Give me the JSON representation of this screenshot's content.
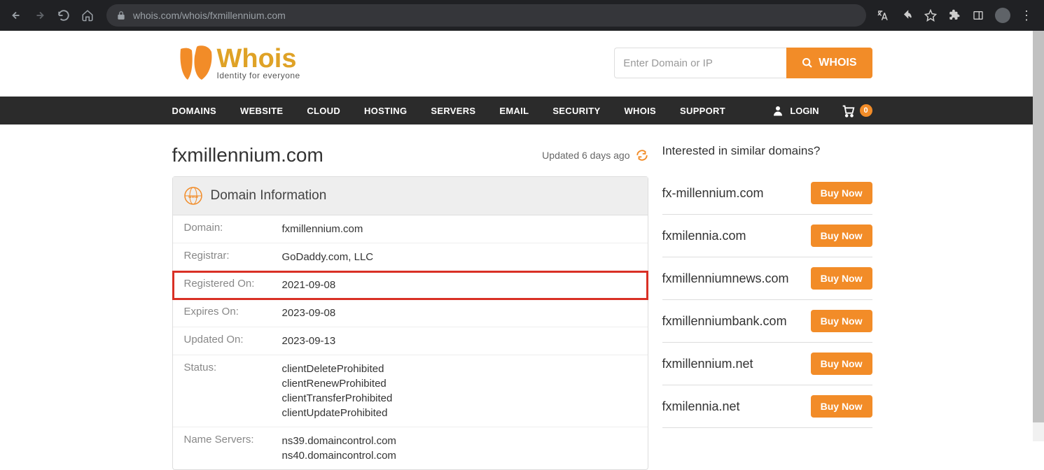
{
  "browser": {
    "url": "whois.com/whois/fxmillennium.com"
  },
  "logo": {
    "title": "Whois",
    "subtitle": "Identity for everyone"
  },
  "search": {
    "placeholder": "Enter Domain or IP",
    "button": "WHOIS"
  },
  "nav": {
    "items": [
      "DOMAINS",
      "WEBSITE",
      "CLOUD",
      "HOSTING",
      "SERVERS",
      "EMAIL",
      "SECURITY",
      "WHOIS",
      "SUPPORT"
    ],
    "login": "LOGIN",
    "cart_count": "0"
  },
  "main": {
    "domain_title": "fxmillennium.com",
    "updated_text": "Updated 6 days ago",
    "card_title": "Domain Information",
    "rows": [
      {
        "label": "Domain:",
        "value": "fxmillennium.com",
        "highlight": false
      },
      {
        "label": "Registrar:",
        "value": "GoDaddy.com, LLC",
        "highlight": false
      },
      {
        "label": "Registered On:",
        "value": "2021-09-08",
        "highlight": true
      },
      {
        "label": "Expires On:",
        "value": "2023-09-08",
        "highlight": false
      },
      {
        "label": "Updated On:",
        "value": "2023-09-13",
        "highlight": false
      },
      {
        "label": "Status:",
        "value": "clientDeleteProhibited\nclientRenewProhibited\nclientTransferProhibited\nclientUpdateProhibited",
        "highlight": false
      },
      {
        "label": "Name Servers:",
        "value": "ns39.domaincontrol.com\nns40.domaincontrol.com",
        "highlight": false
      }
    ]
  },
  "sidebar": {
    "title": "Interested in similar domains?",
    "buy_label": "Buy Now",
    "items": [
      "fx-millennium.com",
      "fxmilennia.com",
      "fxmillenniumnews.com",
      "fxmillenniumbank.com",
      "fxmillennium.net",
      "fxmilennia.net"
    ]
  }
}
